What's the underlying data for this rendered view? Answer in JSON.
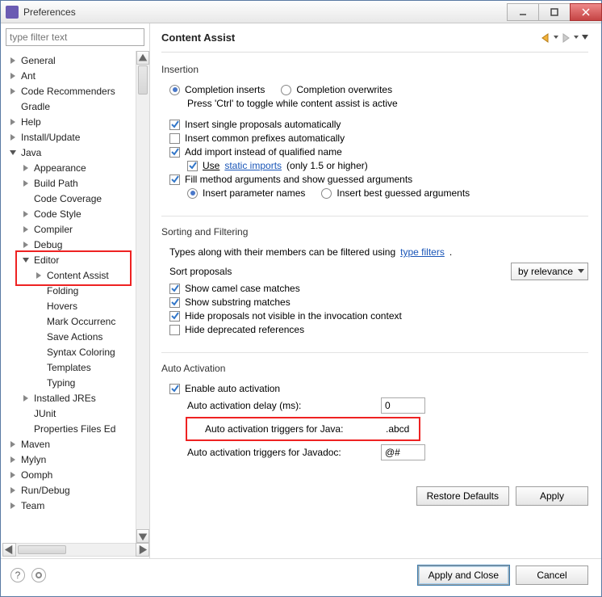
{
  "window": {
    "title": "Preferences"
  },
  "header": {
    "title": "Content Assist"
  },
  "tree": [
    {
      "label": "General",
      "indent": 0,
      "expand": "closed"
    },
    {
      "label": "Ant",
      "indent": 0,
      "expand": "closed"
    },
    {
      "label": "Code Recommenders",
      "indent": 0,
      "expand": "closed"
    },
    {
      "label": "Gradle",
      "indent": 0,
      "expand": "none"
    },
    {
      "label": "Help",
      "indent": 0,
      "expand": "closed"
    },
    {
      "label": "Install/Update",
      "indent": 0,
      "expand": "closed"
    },
    {
      "label": "Java",
      "indent": 0,
      "expand": "open"
    },
    {
      "label": "Appearance",
      "indent": 1,
      "expand": "closed"
    },
    {
      "label": "Build Path",
      "indent": 1,
      "expand": "closed"
    },
    {
      "label": "Code Coverage",
      "indent": 1,
      "expand": "none"
    },
    {
      "label": "Code Style",
      "indent": 1,
      "expand": "closed"
    },
    {
      "label": "Compiler",
      "indent": 1,
      "expand": "closed"
    },
    {
      "label": "Debug",
      "indent": 1,
      "expand": "closed"
    },
    {
      "label": "Editor",
      "indent": 1,
      "expand": "open",
      "redstart": true
    },
    {
      "label": "Content Assist",
      "indent": 2,
      "expand": "closed",
      "redend": true
    },
    {
      "label": "Folding",
      "indent": 2,
      "expand": "none"
    },
    {
      "label": "Hovers",
      "indent": 2,
      "expand": "none"
    },
    {
      "label": "Mark Occurrenc",
      "indent": 2,
      "expand": "none"
    },
    {
      "label": "Save Actions",
      "indent": 2,
      "expand": "none"
    },
    {
      "label": "Syntax Coloring",
      "indent": 2,
      "expand": "none"
    },
    {
      "label": "Templates",
      "indent": 2,
      "expand": "none"
    },
    {
      "label": "Typing",
      "indent": 2,
      "expand": "none"
    },
    {
      "label": "Installed JREs",
      "indent": 1,
      "expand": "closed"
    },
    {
      "label": "JUnit",
      "indent": 1,
      "expand": "none"
    },
    {
      "label": "Properties Files Ed",
      "indent": 1,
      "expand": "none"
    },
    {
      "label": "Maven",
      "indent": 0,
      "expand": "closed"
    },
    {
      "label": "Mylyn",
      "indent": 0,
      "expand": "closed"
    },
    {
      "label": "Oomph",
      "indent": 0,
      "expand": "closed"
    },
    {
      "label": "Run/Debug",
      "indent": 0,
      "expand": "closed"
    },
    {
      "label": "Team",
      "indent": 0,
      "expand": "closed"
    }
  ],
  "insertion": {
    "title": "Insertion",
    "r1": "Completion inserts",
    "r2": "Completion overwrites",
    "hint": "Press 'Ctrl' to toggle while content assist is active",
    "c1": "Insert single proposals automatically",
    "c2": "Insert common prefixes automatically",
    "c3": "Add import instead of qualified name",
    "c3a": "Use ",
    "c3a_link": "static imports",
    "c3a_tail": " (only 1.5 or higher)",
    "c4": "Fill method arguments and show guessed arguments",
    "r3": "Insert parameter names",
    "r4": "Insert best guessed arguments"
  },
  "sorting": {
    "title": "Sorting and Filtering",
    "line": "Types along with their members can be filtered using ",
    "link": "type filters",
    "dot": ".",
    "sortlabel": "Sort proposals",
    "combo": "by relevance",
    "c1": "Show camel case matches",
    "c2": "Show substring matches",
    "c3": "Hide proposals not visible in the invocation context",
    "c4": "Hide deprecated references"
  },
  "auto": {
    "title": "Auto Activation",
    "c1": "Enable auto activation",
    "l1": "Auto activation delay (ms):",
    "v1": "0",
    "l2": "Auto activation triggers for Java:",
    "v2": ".abcd",
    "l3": "Auto activation triggers for Javadoc:",
    "v3": "@#"
  },
  "buttons": {
    "restore": "Restore Defaults",
    "apply": "Apply",
    "applyclose": "Apply and Close",
    "cancel": "Cancel"
  },
  "filter_placeholder": "type filter text"
}
